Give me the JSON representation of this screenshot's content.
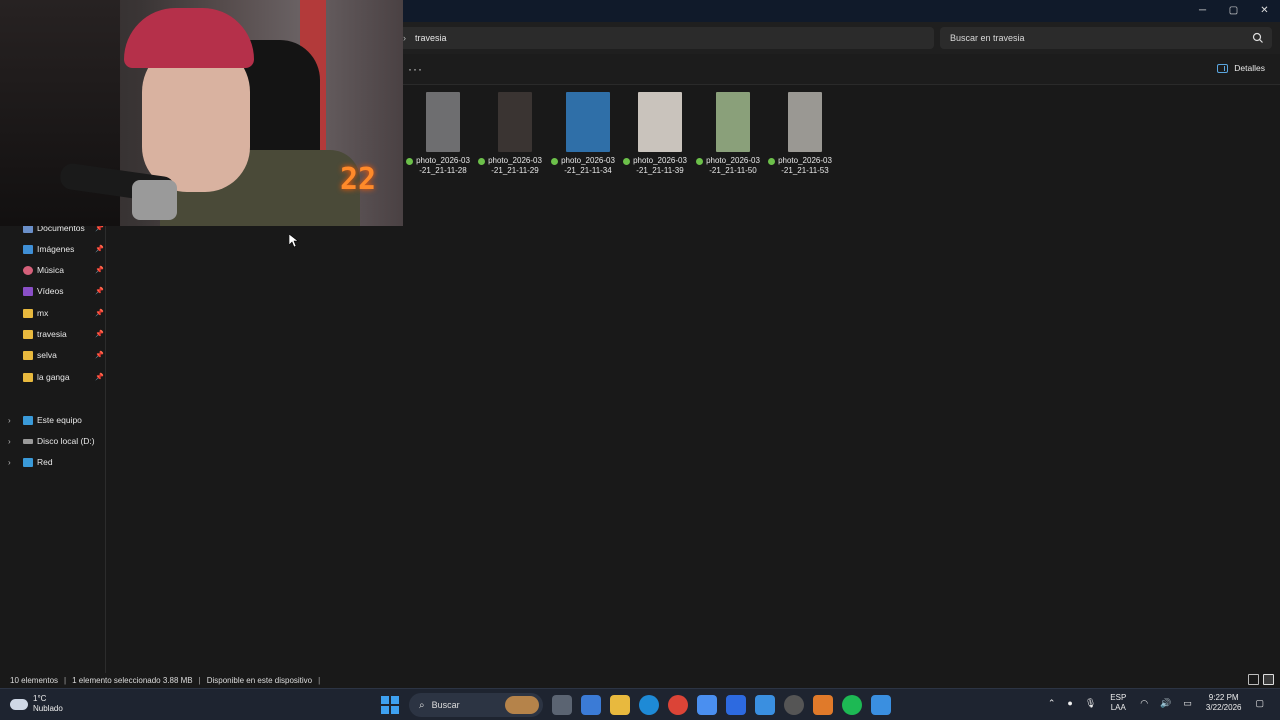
{
  "window": {
    "controls": {
      "minimize": "─",
      "maximize": "▢",
      "close": "✕"
    }
  },
  "address": {
    "chevron": "›",
    "path": "travesia",
    "search_placeholder": "Buscar en travesia"
  },
  "command_bar": {
    "more": "···",
    "details_label": "Detalles"
  },
  "nav": {
    "quick_access": [
      {
        "label": "Documentos",
        "icon": "documents-icon"
      },
      {
        "label": "Imágenes",
        "icon": "pictures-icon"
      },
      {
        "label": "Música",
        "icon": "music-icon"
      },
      {
        "label": "Vídeos",
        "icon": "videos-icon"
      },
      {
        "label": "mx",
        "icon": "folder-icon"
      },
      {
        "label": "travesia",
        "icon": "folder-icon"
      },
      {
        "label": "selva",
        "icon": "folder-icon"
      },
      {
        "label": "la ganga",
        "icon": "folder-icon"
      }
    ],
    "pin_glyph": "📌",
    "expand_glyph": "›",
    "drives": [
      {
        "label": "Este equipo",
        "icon": "computer-icon"
      },
      {
        "label": "Disco local (D:)",
        "icon": "drive-icon"
      },
      {
        "label": "Red",
        "icon": "network-icon"
      }
    ]
  },
  "files": [
    {
      "line1": "photo_2026-03",
      "line2": "-21_21-11-28",
      "thumb_color": "#6e6e70"
    },
    {
      "line1": "photo_2026-03",
      "line2": "-21_21-11-29",
      "thumb_color": "#3a3432"
    },
    {
      "line1": "photo_2026-03",
      "line2": "-21_21-11-34",
      "thumb_color": "#2f6fa8"
    },
    {
      "line1": "photo_2026-03",
      "line2": "-21_21-11-39",
      "thumb_color": "#c9c3bc"
    },
    {
      "line1": "photo_2026-03",
      "line2": "-21_21-11-50",
      "thumb_color": "#8aa07a"
    },
    {
      "line1": "photo_2026-03",
      "line2": "-21_21-11-53",
      "thumb_color": "#9a9893"
    }
  ],
  "webcam": {
    "overlay_number": "22"
  },
  "status": {
    "count": "10 elementos",
    "selection": "1 elemento seleccionado  3.88 MB",
    "availability": "Disponible en este dispositivo",
    "divider": "|"
  },
  "taskbar": {
    "weather_temp": "1°C",
    "weather_desc": "Nublado",
    "search_label": "Buscar",
    "lang_line1": "ESP",
    "lang_line2": "LAA",
    "time": "9:22 PM",
    "date": "3/22/2026"
  }
}
